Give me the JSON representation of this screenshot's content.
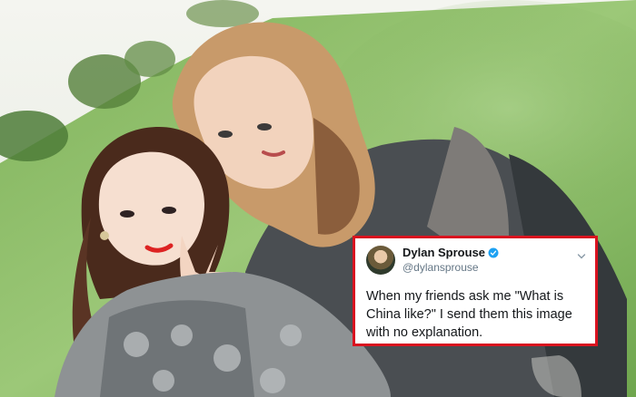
{
  "tweet": {
    "display_name": "Dylan Sprouse",
    "handle": "@dylansprouse",
    "text": "When my friends ask me \"What is China like?\" I send them this image with no explanation.",
    "verified": true
  },
  "colors": {
    "highlight_border": "#d9121f",
    "verified_blue": "#1da1f2",
    "grass": "#8fbf6a"
  }
}
